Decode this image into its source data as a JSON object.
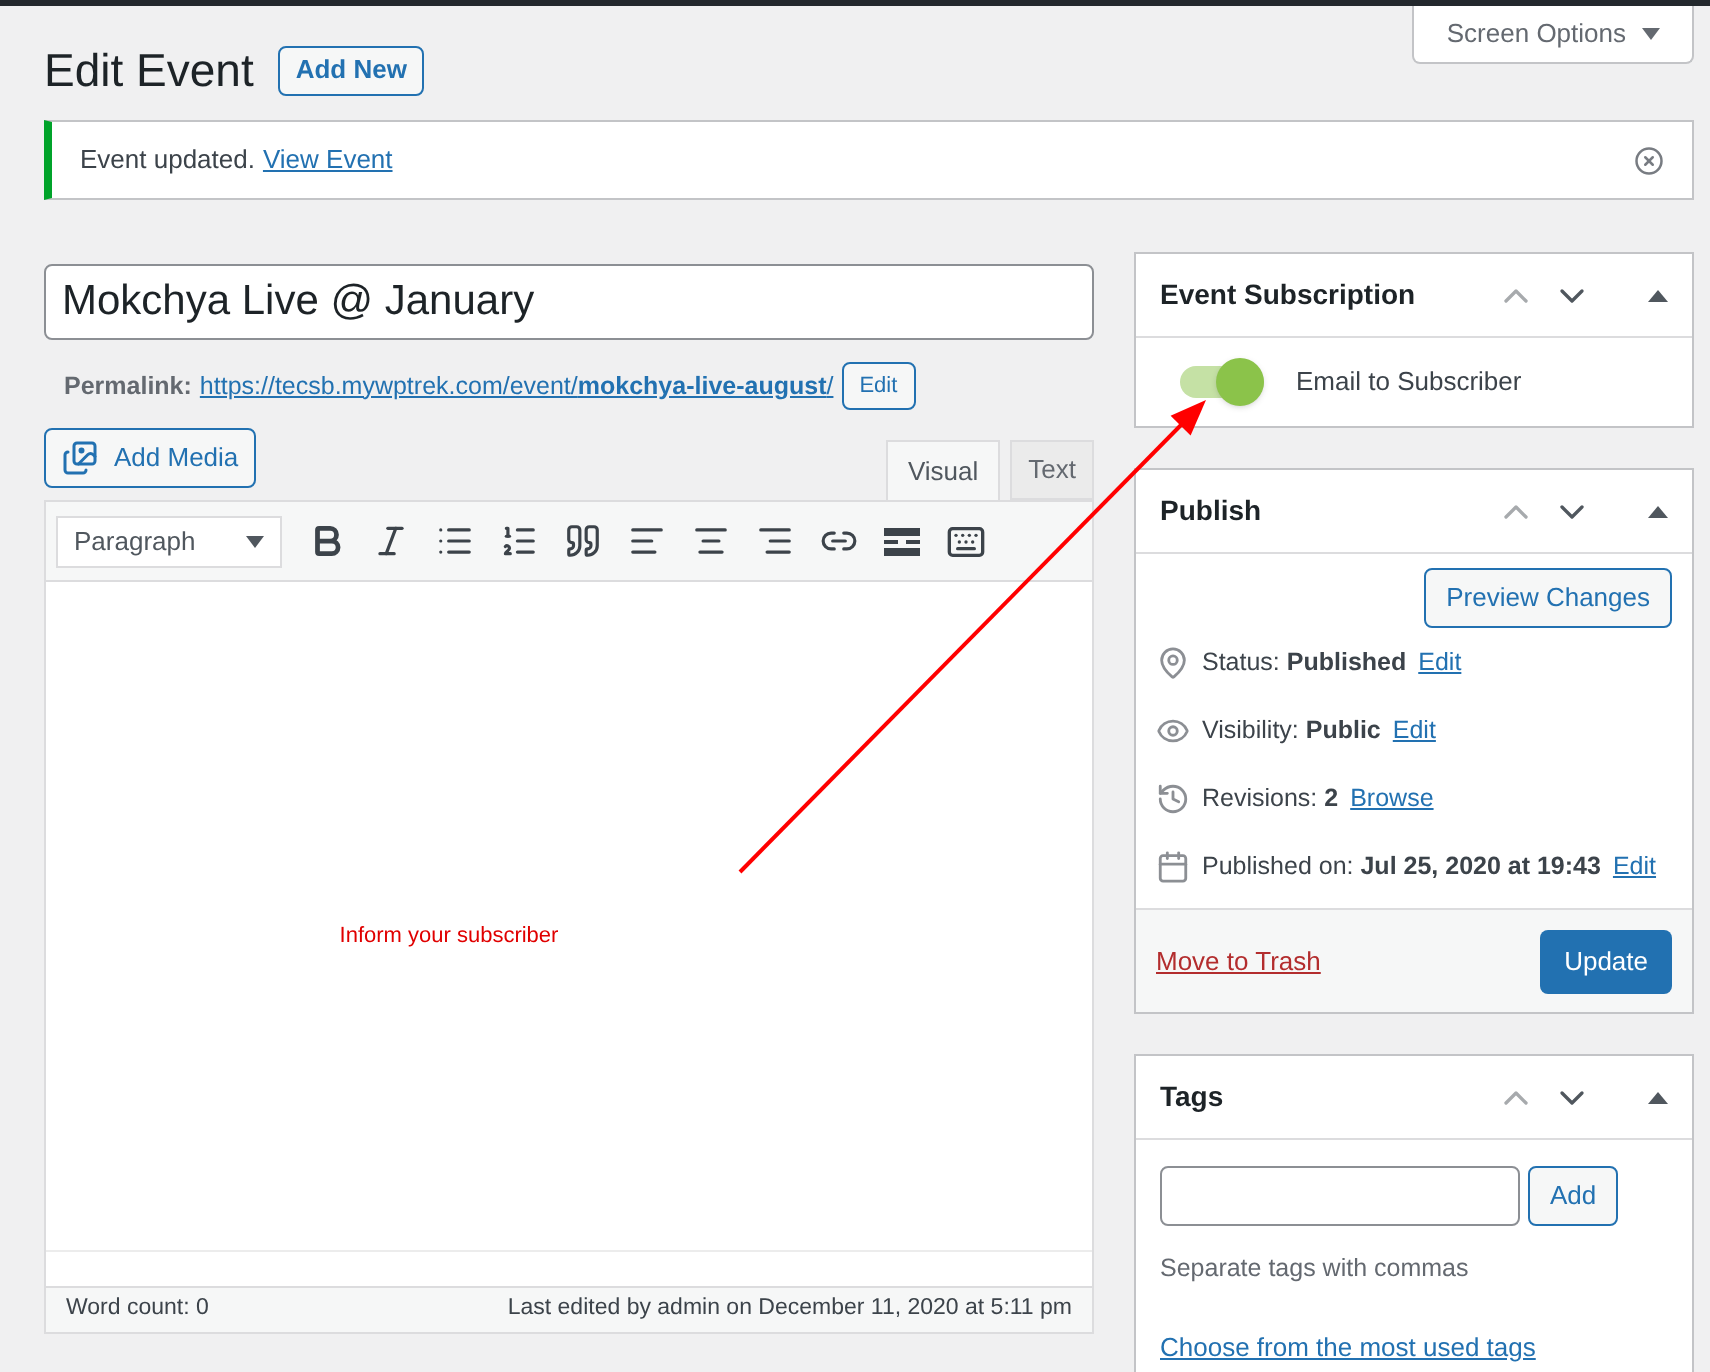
{
  "screen_options": {
    "label": "Screen Options"
  },
  "heading": {
    "title": "Edit Event",
    "add_new": "Add New"
  },
  "notice": {
    "text": "Event updated.",
    "link": "View Event"
  },
  "title_field": {
    "value": "Mokchya Live @ January"
  },
  "permalink": {
    "label": "Permalink:",
    "url": "https://tecsb.mywptrek.com/event/**mokchya-live-august**/",
    "edit": "Edit"
  },
  "editor": {
    "add_media": "Add Media",
    "tabs": [
      {
        "label": "Visual",
        "selected": true
      },
      {
        "label": "Text",
        "selected": false
      }
    ],
    "format": "Paragraph",
    "annotation": "Inform your subscriber",
    "word_count": "Word count: 0",
    "last_edited": "Last edited by admin on December 11, 2020 at 5:11 pm"
  },
  "subscription": {
    "title": "Event Subscription",
    "toggle": {
      "label": "Email to Subscriber",
      "on": true
    }
  },
  "publish": {
    "title": "Publish",
    "preview": "Preview Changes",
    "rows": [
      {
        "kind": "status",
        "text": "Status: **Published**",
        "link": "Edit"
      },
      {
        "kind": "visibility",
        "text": "Visibility: **Public**",
        "link": "Edit"
      },
      {
        "kind": "revisions",
        "text": "Revisions: **2**",
        "link": "Browse"
      },
      {
        "kind": "date",
        "text": "Published on: **Jul 25, 2020 at 19:43**",
        "link": "Edit"
      }
    ],
    "trash": "Move to Trash",
    "update": "Update"
  },
  "tags": {
    "title": "Tags",
    "add": "Add",
    "hint": "Separate tags with commas",
    "link": "Choose from the most used tags"
  }
}
